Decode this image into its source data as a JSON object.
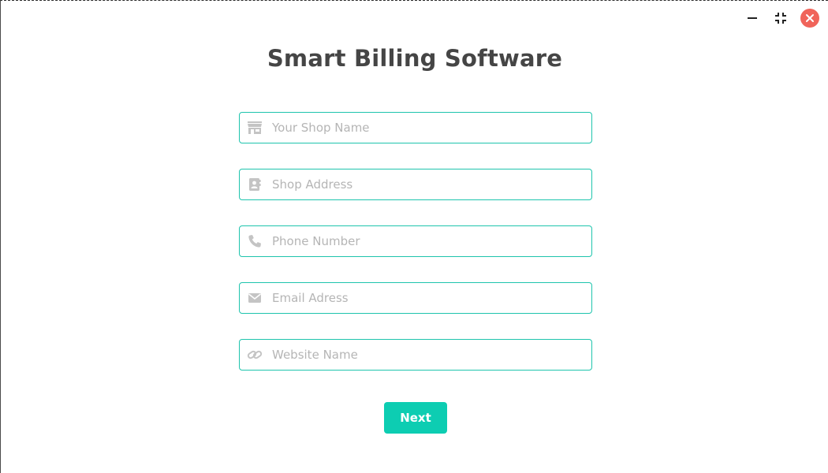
{
  "app": {
    "title": "Smart Billing Software"
  },
  "window_controls": {
    "minimize_icon": "minimize-icon",
    "restore_icon": "restore-icon",
    "close_icon": "close-icon",
    "close_color": "#f0645a"
  },
  "form": {
    "accent_color": "#1ec4ad",
    "fields": [
      {
        "icon": "store-icon",
        "placeholder": "Your Shop Name",
        "value": ""
      },
      {
        "icon": "address-card-icon",
        "placeholder": "Shop Address",
        "value": ""
      },
      {
        "icon": "phone-icon",
        "placeholder": "Phone Number",
        "value": ""
      },
      {
        "icon": "envelope-icon",
        "placeholder": "Email Adress",
        "value": ""
      },
      {
        "icon": "link-icon",
        "placeholder": "Website Name",
        "value": ""
      }
    ],
    "next_label": "Next",
    "next_color": "#0dcdb2"
  }
}
